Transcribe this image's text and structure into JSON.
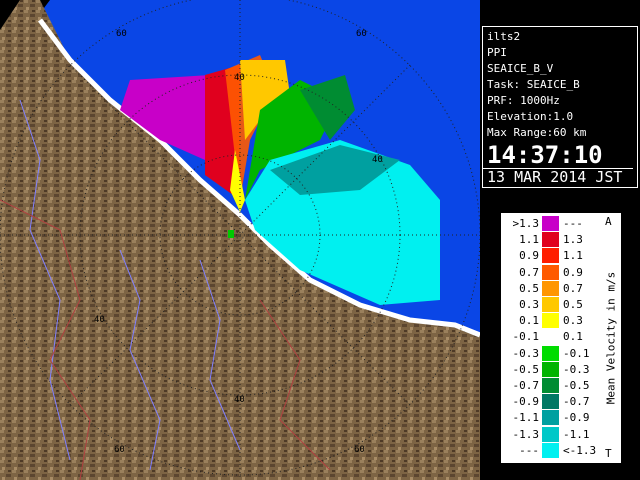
{
  "info": {
    "lines": [
      "ilts2",
      "PPI",
      "SEAICE_B_V",
      "Task: SEAICE_B",
      "PRF: 1000Hz",
      "Elevation:1.0",
      "Max Range:60 km"
    ],
    "time": "14:37:10",
    "date": "13 MAR 2014 JST"
  },
  "range_labels": {
    "top_60": "60",
    "top_right_60": "60",
    "top_40": "40",
    "right_40": "40",
    "left_40": "40",
    "bottom_40": "40",
    "bottom_left_60": "60",
    "bottom_60": "60"
  },
  "legend": {
    "title": "Mean Velocity in m/s",
    "top_marker": "A",
    "bottom_marker": "T",
    "rows": [
      {
        "left": ">1.3",
        "right": "---",
        "color": "#c800c8"
      },
      {
        "left": "1.1",
        "right": "1.3",
        "color": "#e0001e"
      },
      {
        "left": "0.9",
        "right": "1.1",
        "color": "#ff1e00"
      },
      {
        "left": "0.7",
        "right": "0.9",
        "color": "#ff5a00"
      },
      {
        "left": "0.5",
        "right": "0.7",
        "color": "#ff9600"
      },
      {
        "left": "0.3",
        "right": "0.5",
        "color": "#ffc800"
      },
      {
        "left": "0.1",
        "right": "0.3",
        "color": "#ffff00"
      },
      {
        "left": "-0.1",
        "right": "0.1",
        "color": "#ffffff"
      },
      {
        "left": "-0.3",
        "right": "-0.1",
        "color": "#00dc00"
      },
      {
        "left": "-0.5",
        "right": "-0.3",
        "color": "#00b400"
      },
      {
        "left": "-0.7",
        "right": "-0.5",
        "color": "#008c32"
      },
      {
        "left": "-0.9",
        "right": "-0.7",
        "color": "#007864"
      },
      {
        "left": "-1.1",
        "right": "-0.9",
        "color": "#00a0a0"
      },
      {
        "left": "-1.3",
        "right": "-1.1",
        "color": "#00c8c8"
      },
      {
        "left": "---",
        "right": "<-1.3",
        "color": "#00f0f0"
      }
    ]
  },
  "colors": {
    "sea": "#0a46e6",
    "land": "#7a6040",
    "coast_white": "#ffffff",
    "river": "#8080ff",
    "boundary": "#b04040"
  }
}
